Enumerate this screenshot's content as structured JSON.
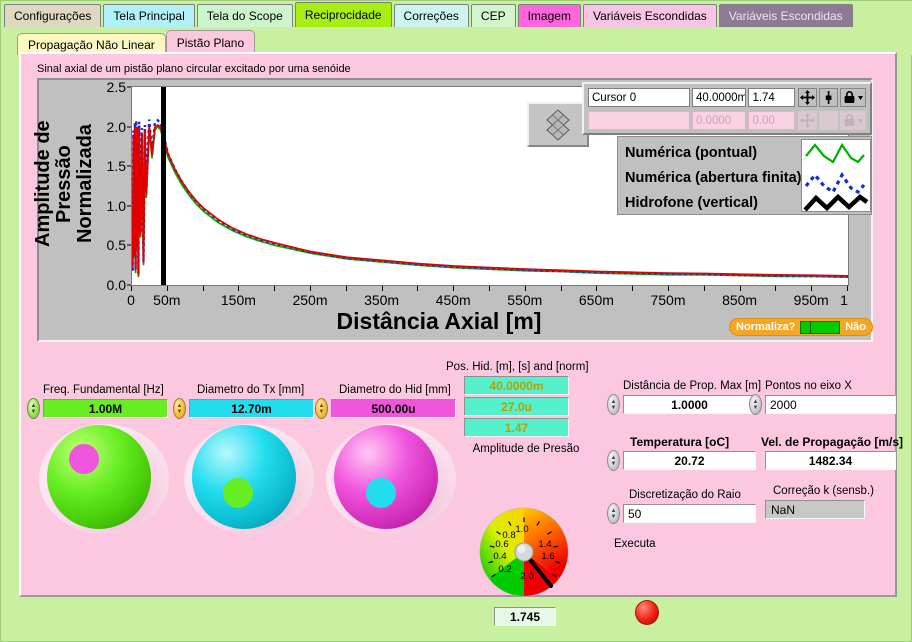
{
  "tabs": [
    {
      "label": "Configurações",
      "bg": "#ded8c0",
      "selected": false
    },
    {
      "label": "Tela Principal",
      "bg": "#b0f0f8",
      "selected": false
    },
    {
      "label": "Tela do Scope",
      "bg": "#ccf5cc",
      "selected": false
    },
    {
      "label": "Reciprocidade",
      "bg": "#a8ee10",
      "selected": true
    },
    {
      "label": "Correções",
      "bg": "#ccf5f0",
      "selected": false
    },
    {
      "label": "CEP",
      "bg": "#d4f5cc",
      "selected": false
    },
    {
      "label": "Imagem",
      "bg": "#ff66dd",
      "selected": false
    },
    {
      "label": "Variáveis Escondidas",
      "bg": "#f7c4e4",
      "selected": false
    },
    {
      "label": "Variáveis Escondidas",
      "bg": "#8f7a96",
      "selected": false
    }
  ],
  "subtabs": [
    {
      "label": "Propagação Não Linear",
      "bg": "#fdf7c0",
      "selected": false
    },
    {
      "label": "Pistão Plano",
      "bg": "#fcc8e0",
      "selected": true
    }
  ],
  "panel": {
    "caption": "Sinal axial de um pistão plano circular excitado por uma senóide"
  },
  "chart_data": {
    "type": "line",
    "title": "Sinal axial de um pistão plano circular excitado por uma senóide",
    "xlabel": "Distância Axial [m]",
    "ylabel": "Amplitude de Pressão Normalizada",
    "xlim": [
      0,
      1.0
    ],
    "ylim": [
      0.0,
      2.5
    ],
    "grid": false,
    "x_ticks": [
      "0",
      "50m",
      "150m",
      "250m",
      "350m",
      "450m",
      "550m",
      "650m",
      "750m",
      "850m",
      "950m",
      "1"
    ],
    "x_tick_values": [
      0,
      0.05,
      0.15,
      0.25,
      0.35,
      0.45,
      0.55,
      0.65,
      0.75,
      0.85,
      0.95,
      1.0
    ],
    "y_ticks": [
      "0.0",
      "0.5",
      "1.0",
      "1.5",
      "2.0",
      "2.5"
    ],
    "y_tick_values": [
      0.0,
      0.5,
      1.0,
      1.5,
      2.0,
      2.5
    ],
    "cursor_x": 0.04,
    "series": [
      {
        "name": "Numérica (pontual)",
        "color": "#00b000",
        "style": "line",
        "x": [
          0.001,
          0.002,
          0.003,
          0.004,
          0.005,
          0.006,
          0.007,
          0.008,
          0.009,
          0.01,
          0.012,
          0.014,
          0.016,
          0.018,
          0.02,
          0.024,
          0.028,
          0.032,
          0.036,
          0.04,
          0.045,
          0.05,
          0.06,
          0.07,
          0.08,
          0.09,
          0.1,
          0.12,
          0.14,
          0.16,
          0.18,
          0.2,
          0.25,
          0.3,
          0.35,
          0.4,
          0.45,
          0.5,
          0.55,
          0.6,
          0.65,
          0.7,
          0.75,
          0.8,
          0.85,
          0.9,
          0.95,
          1.0
        ],
        "y": [
          0.2,
          1.85,
          0.35,
          1.95,
          0.15,
          1.98,
          0.45,
          1.9,
          0.1,
          1.96,
          0.6,
          1.88,
          0.25,
          1.92,
          1.1,
          1.99,
          1.6,
          1.96,
          2.0,
          1.96,
          1.8,
          1.62,
          1.42,
          1.26,
          1.13,
          1.02,
          0.93,
          0.79,
          0.69,
          0.61,
          0.55,
          0.5,
          0.4,
          0.33,
          0.29,
          0.25,
          0.22,
          0.2,
          0.18,
          0.17,
          0.15,
          0.14,
          0.13,
          0.13,
          0.12,
          0.11,
          0.11,
          0.1
        ]
      },
      {
        "name": "Numérica (abertura finita)",
        "color": "#1030d0",
        "style": "dashed",
        "x": [
          0.001,
          0.002,
          0.003,
          0.004,
          0.005,
          0.006,
          0.007,
          0.008,
          0.009,
          0.01,
          0.012,
          0.014,
          0.016,
          0.018,
          0.02,
          0.024,
          0.028,
          0.032,
          0.036,
          0.04,
          0.045,
          0.05,
          0.06,
          0.07,
          0.08,
          0.09,
          0.1,
          0.12,
          0.14,
          0.16,
          0.18,
          0.2,
          0.25,
          0.3,
          0.35,
          0.4,
          0.45,
          0.5,
          0.55,
          0.6,
          0.65,
          0.7,
          0.75,
          0.8,
          0.85,
          0.9,
          0.95,
          1.0
        ],
        "y": [
          0.18,
          1.95,
          0.4,
          2.05,
          0.2,
          2.08,
          0.5,
          2.0,
          0.14,
          2.06,
          0.66,
          1.98,
          0.3,
          2.02,
          1.18,
          2.09,
          1.68,
          2.05,
          2.08,
          2.04,
          1.86,
          1.66,
          1.46,
          1.3,
          1.16,
          1.05,
          0.96,
          0.82,
          0.71,
          0.63,
          0.57,
          0.52,
          0.41,
          0.34,
          0.3,
          0.26,
          0.23,
          0.21,
          0.19,
          0.175,
          0.16,
          0.15,
          0.14,
          0.135,
          0.125,
          0.118,
          0.112,
          0.105
        ]
      },
      {
        "name": "Hidrofone (vertical)",
        "color": "#e00000",
        "style": "line",
        "x": [
          0.001,
          0.002,
          0.003,
          0.004,
          0.005,
          0.006,
          0.007,
          0.008,
          0.009,
          0.01,
          0.012,
          0.014,
          0.016,
          0.018,
          0.02,
          0.024,
          0.028,
          0.032,
          0.036,
          0.04,
          0.045,
          0.05,
          0.06,
          0.07,
          0.08,
          0.09,
          0.1,
          0.12,
          0.14,
          0.16,
          0.18,
          0.2,
          0.25,
          0.3,
          0.35,
          0.4,
          0.45,
          0.5,
          0.55,
          0.6,
          0.65,
          0.7,
          0.75,
          0.8,
          0.85,
          0.9,
          0.95,
          1.0
        ],
        "y": [
          0.22,
          1.88,
          0.38,
          1.99,
          0.18,
          2.0,
          0.48,
          1.93,
          0.12,
          1.99,
          0.63,
          1.91,
          0.28,
          1.95,
          1.14,
          2.01,
          1.64,
          1.99,
          2.02,
          1.99,
          1.84,
          1.66,
          1.46,
          1.3,
          1.17,
          1.06,
          0.97,
          0.83,
          0.72,
          0.64,
          0.58,
          0.53,
          0.42,
          0.35,
          0.31,
          0.27,
          0.24,
          0.22,
          0.2,
          0.185,
          0.17,
          0.16,
          0.15,
          0.145,
          0.135,
          0.128,
          0.122,
          0.115
        ]
      }
    ],
    "legend_position": "inside-right",
    "legend": [
      {
        "label": "Numérica (pontual)",
        "color": "#00b000",
        "style": "zigzag-line"
      },
      {
        "label": "Numérica (abertura finita)",
        "color": "#1030d0",
        "style": "zigzag-dashed"
      },
      {
        "label": "Hidrofone (vertical)",
        "color": "#000000",
        "style": "zigzag-thick"
      }
    ]
  },
  "cursor_legend": {
    "rows": [
      {
        "name": "Cursor 0",
        "x": "40.0000m",
        "y": "1.74",
        "active": true
      },
      {
        "name": "",
        "x": "0.0000",
        "y": "0.00",
        "active": false
      }
    ],
    "buttons": [
      "move-cursor-icon",
      "cursor-center-icon",
      "lock-icon"
    ]
  },
  "normaliza": {
    "label": "Normaliza?",
    "value": "Não"
  },
  "controls": {
    "freq": {
      "label": "Freq. Fundamental [Hz]",
      "value": "1.00M",
      "color": "#66ee22"
    },
    "diam_tx": {
      "label": "Diametro do Tx [mm]",
      "value": "12.70m",
      "color": "#22ddee"
    },
    "diam_hid": {
      "label": "Diametro do Hid [mm]",
      "value": "500.00u",
      "color": "#f055dd"
    },
    "pos_hid": {
      "label": "Pos. Hid. [m], [s] and [norm]",
      "values": [
        "40.0000m",
        "27.0u",
        "1.47"
      ]
    },
    "amplitude": {
      "label": "Amplitude de Presão",
      "value": "1.745",
      "gauge_min": 0.0,
      "gauge_max": 2.0,
      "gauge_ticks": [
        "0.2",
        "0.4",
        "0.6",
        "0.8",
        "1.0",
        "1.4",
        "1.6",
        "2.0"
      ]
    },
    "dist_prop": {
      "label": "Distância de Prop. Max [m]",
      "value": "1.0000"
    },
    "pontos_x": {
      "label": "Pontos no eixo X",
      "value": "2000"
    },
    "temperatura": {
      "label": "Temperatura [oC]",
      "value": "20.72"
    },
    "vel_prop": {
      "label": "Vel. de Propagação [m/s]",
      "value": "1482.34"
    },
    "discret_raio": {
      "label": "Discretização do Raio",
      "value": "50"
    },
    "correcao_k": {
      "label": "Correção k (sensb.)",
      "value": "NaN"
    },
    "executa": {
      "label": "Executa"
    }
  }
}
